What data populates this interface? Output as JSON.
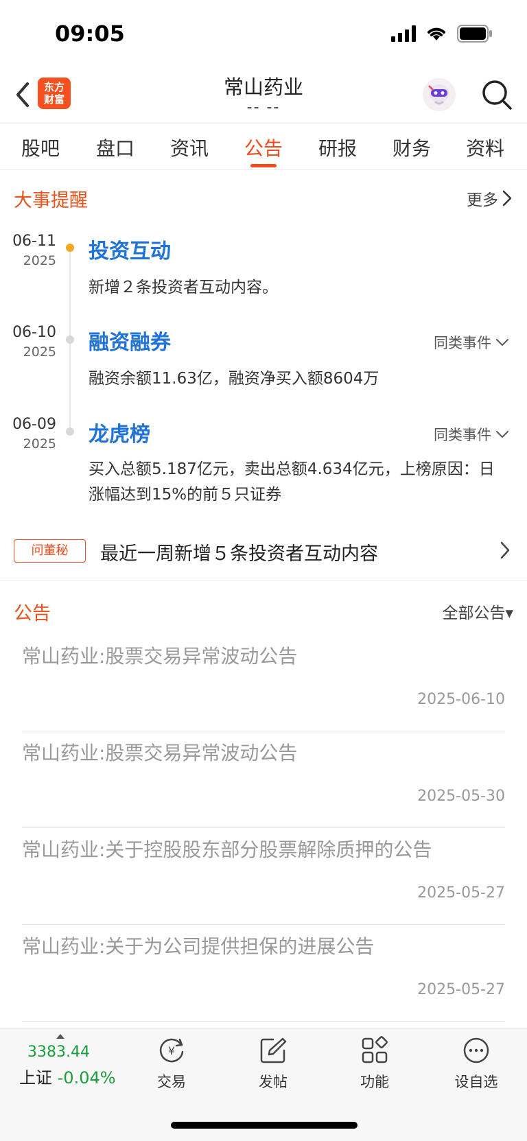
{
  "status_bar": {
    "time": "09:05"
  },
  "header": {
    "logo_line1": "东方",
    "logo_line2": "财富",
    "title": "常山药业",
    "subtitle": "-- --"
  },
  "tabs": [
    {
      "label": "股吧"
    },
    {
      "label": "盘口"
    },
    {
      "label": "资讯"
    },
    {
      "label": "公告",
      "active": true
    },
    {
      "label": "研报"
    },
    {
      "label": "财务"
    },
    {
      "label": "资料"
    }
  ],
  "events_section": {
    "title": "大事提醒",
    "more": "更多",
    "events": [
      {
        "date": "06-11",
        "year": "2025",
        "title": "投资互动",
        "desc": "新增２条投资者互动内容。",
        "similar": ""
      },
      {
        "date": "06-10",
        "year": "2025",
        "title": "融资融券",
        "desc": "融资余额11.63亿，融资净买入额8604万",
        "similar": "同类事件"
      },
      {
        "date": "06-09",
        "year": "2025",
        "title": "龙虎榜",
        "desc": "买入总额5.187亿元，卖出总额4.634亿元，上榜原因：日涨幅达到15%的前５只证券",
        "similar": "同类事件"
      }
    ]
  },
  "secretary": {
    "badge": "问董秘",
    "text": "最近一周新增５条投资者互动内容"
  },
  "notices_section": {
    "title": "公告",
    "filter": "全部公告▾",
    "items": [
      {
        "title": "常山药业:股票交易异常波动公告",
        "date": "2025-06-10"
      },
      {
        "title": "常山药业:股票交易异常波动公告",
        "date": "2025-05-30"
      },
      {
        "title": "常山药业:关于控股股东部分股票解除质押的公告",
        "date": "2025-05-27"
      },
      {
        "title": "常山药业:关于为公司提供担保的进展公告",
        "date": "2025-05-27"
      }
    ]
  },
  "bottom_bar": {
    "index_value": "3383.44",
    "index_name": "上证",
    "index_change": "-0.04%",
    "nav": [
      {
        "label": "交易",
        "icon": "yen-exchange-icon"
      },
      {
        "label": "发帖",
        "icon": "edit-post-icon"
      },
      {
        "label": "功能",
        "icon": "apps-grid-icon"
      },
      {
        "label": "设自选",
        "icon": "more-dots-icon"
      }
    ]
  },
  "colors": {
    "accent": "#f04d1f",
    "link_blue": "#1f72d8",
    "index_green": "#1a9d3c"
  }
}
